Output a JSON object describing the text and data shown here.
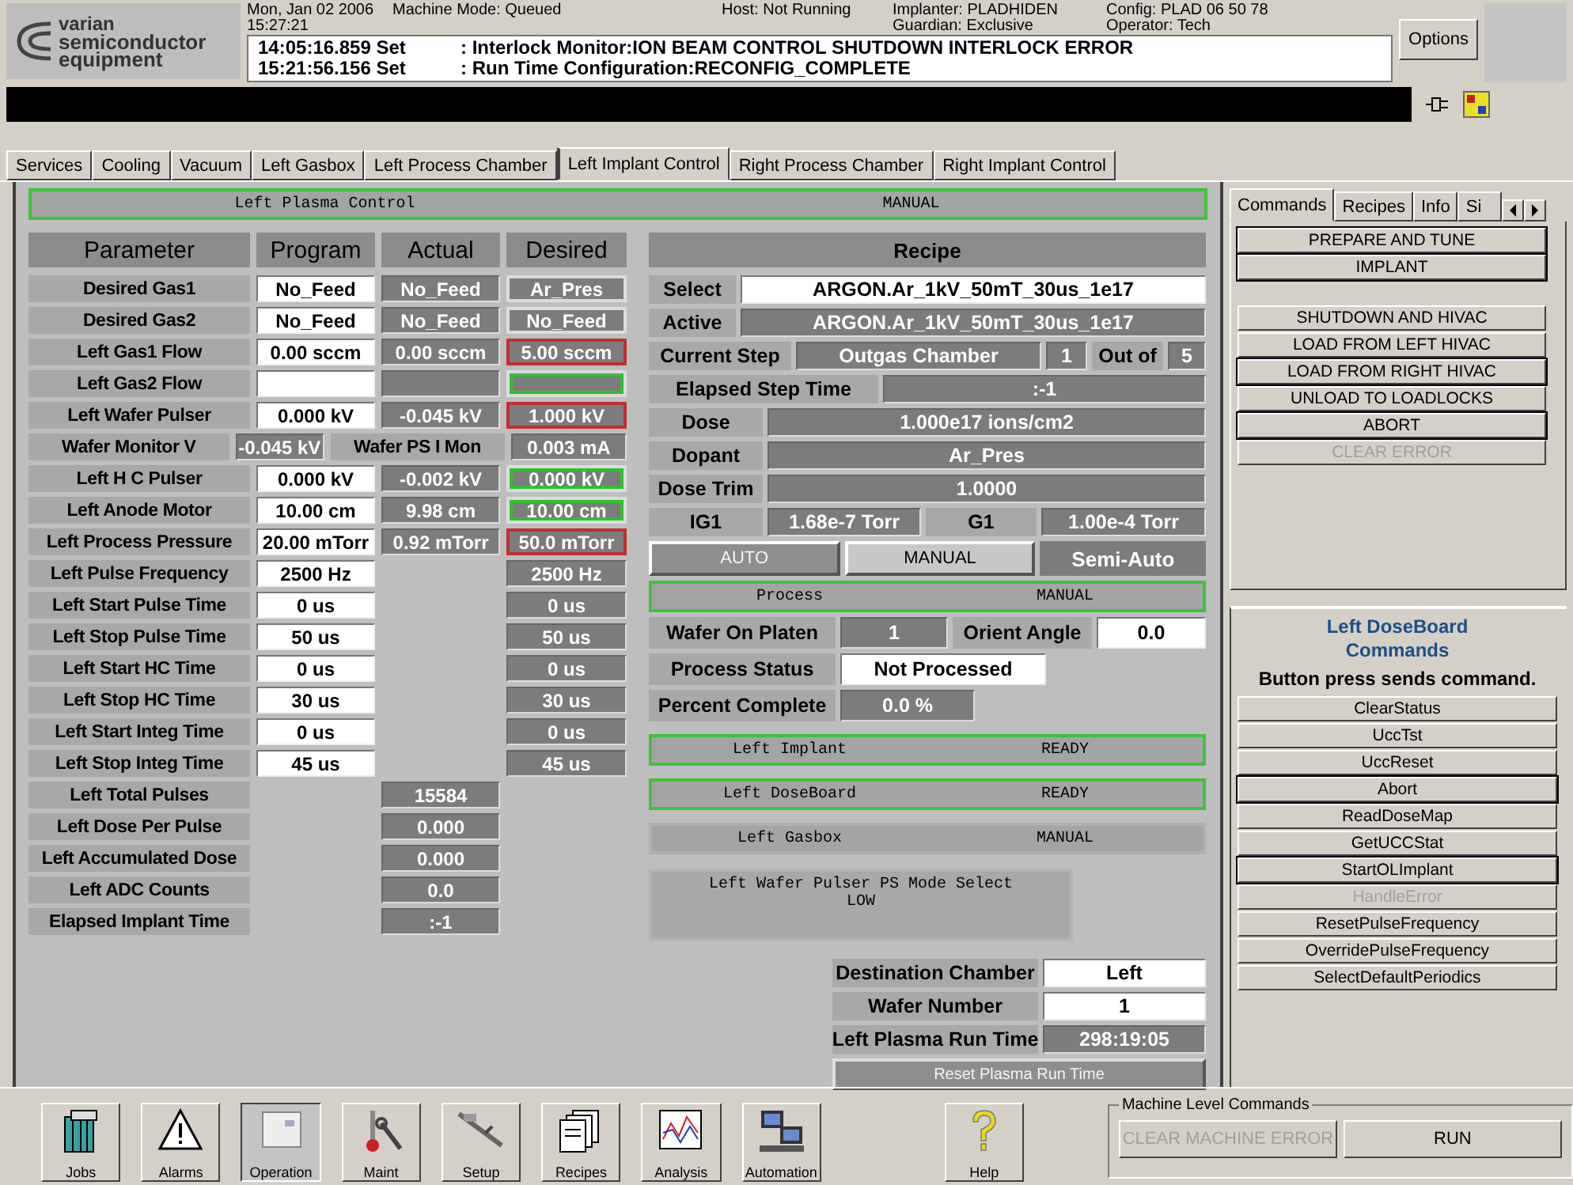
{
  "logo": {
    "lines": [
      "varian",
      "semiconductor",
      "equipment"
    ]
  },
  "header": {
    "date": "Mon, Jan 02 2006",
    "time": "15:27:21",
    "machine_mode": "Machine Mode:  Queued",
    "host": "Host:  Not Running",
    "implanter": "Implanter: PLADHIDEN",
    "guardian": "Guardian: Exclusive",
    "config": "Config: PLAD 06 50 78",
    "operator": "Operator: Tech",
    "options_button": "Options"
  },
  "messages": [
    {
      "time": "14:05:16.859 Set",
      "text": ": Interlock Monitor:ION BEAM CONTROL SHUTDOWN INTERLOCK ERROR"
    },
    {
      "time": "15:21:56.156 Set",
      "text": ": Run Time Configuration:RECONFIG_COMPLETE"
    }
  ],
  "tabs": [
    {
      "label": "Services",
      "selected": false
    },
    {
      "label": "Cooling",
      "selected": false
    },
    {
      "label": "Vacuum",
      "selected": false
    },
    {
      "label": "Left Gasbox",
      "selected": false
    },
    {
      "label": "Left Process Chamber",
      "selected": false
    },
    {
      "label": "Left Implant Control",
      "selected": true
    },
    {
      "label": "Right Process Chamber",
      "selected": false
    },
    {
      "label": "Right Implant Control",
      "selected": false
    }
  ],
  "plasma_bar": {
    "label": "Left Plasma Control",
    "status": "MANUAL",
    "outlined": true
  },
  "parameters": {
    "columns": [
      "Parameter",
      "Program",
      "Actual",
      "Desired"
    ],
    "rows": [
      {
        "kind": "setting",
        "label": "Desired Gas1",
        "program": "No_Feed",
        "actual": "No_Feed",
        "desired": "Ar_Pres",
        "alarm": false,
        "ok": false
      },
      {
        "kind": "setting",
        "label": "Desired Gas2",
        "program": "No_Feed",
        "actual": "No_Feed",
        "desired": "No_Feed",
        "alarm": false,
        "ok": false
      },
      {
        "kind": "setting",
        "label": "Left Gas1 Flow",
        "program": "0.00 sccm",
        "actual": "0.00 sccm",
        "desired": "5.00 sccm",
        "alarm": true,
        "ok": false
      },
      {
        "kind": "setting",
        "label": "Left Gas2 Flow",
        "alarm": false,
        "ok": true
      },
      {
        "kind": "setting",
        "label": "Left Wafer Pulser",
        "program": "0.000 kV",
        "actual": "-0.045 kV",
        "desired": "1.000 kV",
        "alarm": true,
        "ok": false
      },
      {
        "kind": "monitor",
        "label": "Wafer Monitor V",
        "value": "-0.045 kV",
        "label_2": "Wafer PS I Mon",
        "value_2": "0.003 mA"
      },
      {
        "kind": "setting",
        "label": "Left H C Pulser",
        "program": "0.000 kV",
        "actual": "-0.002 kV",
        "desired": "0.000 kV",
        "alarm": false,
        "ok": true
      },
      {
        "kind": "setting",
        "label": "Left Anode Motor",
        "program": "10.00 cm",
        "actual": "9.98 cm",
        "desired": "10.00 cm",
        "alarm": false,
        "ok": true
      },
      {
        "kind": "setting",
        "label": "Left Process Pressure",
        "program": "20.00 mTorr",
        "actual": "0.92 mTorr",
        "desired": "50.0 mTorr",
        "alarm": true,
        "ok": false
      },
      {
        "kind": "timing",
        "label": "Left Pulse Frequency",
        "program": "2500 Hz",
        "desired": "2500 Hz"
      },
      {
        "kind": "timing",
        "label": "Left Start Pulse Time",
        "program": "0 us",
        "desired": "0 us"
      },
      {
        "kind": "timing",
        "label": "Left Stop Pulse Time",
        "program": "50 us",
        "desired": "50 us"
      },
      {
        "kind": "timing",
        "label": "Left Start HC Time",
        "program": "0 us",
        "desired": "0 us"
      },
      {
        "kind": "timing",
        "label": "Left Stop HC Time",
        "program": "30 us",
        "desired": "30 us"
      },
      {
        "kind": "timing",
        "label": "Left Start Integ Time",
        "program": "0 us",
        "desired": "0 us"
      },
      {
        "kind": "timing",
        "label": "Left Stop Integ Time",
        "program": "45 us",
        "desired": "45 us"
      },
      {
        "kind": "readout",
        "label": "Left Total Pulses",
        "actual": "15584"
      },
      {
        "kind": "readout",
        "label": "Left Dose Per Pulse",
        "actual": "0.000"
      },
      {
        "kind": "readout",
        "label": "Left Accumulated Dose",
        "actual": "0.000"
      },
      {
        "kind": "readout",
        "label": "Left ADC Counts",
        "actual": "0.0"
      },
      {
        "kind": "readout",
        "label": "Elapsed Implant Time",
        "actual": ":-1"
      }
    ]
  },
  "recipe": {
    "title": "Recipe",
    "select": {
      "label": "Select",
      "value": "ARGON.Ar_1kV_50mT_30us_1e17"
    },
    "active": {
      "label": "Active",
      "value": "ARGON.Ar_1kV_50mT_30us_1e17"
    },
    "current_step": {
      "label": "Current Step",
      "value": "Outgas Chamber",
      "number": "1",
      "out_of_label": "Out of",
      "total": "5"
    },
    "elapsed": {
      "label": "Elapsed Step Time",
      "value": ":-1"
    },
    "readouts": [
      {
        "label": "Dose",
        "value": "1.000e17 ions/cm2"
      },
      {
        "label": "Dopant",
        "value": "Ar_Pres"
      },
      {
        "label": "Dose Trim",
        "value": "1.0000"
      }
    ],
    "gauges": [
      {
        "label": "IG1",
        "value": "1.68e-7 Torr"
      },
      {
        "label": "G1",
        "value": "1.00e-4 Torr"
      }
    ]
  },
  "mode_buttons": [
    {
      "label": "AUTO",
      "kind": "button",
      "disabled": true
    },
    {
      "label": "MANUAL",
      "kind": "button",
      "disabled": false
    },
    {
      "label": "Semi-Auto",
      "kind": "indicator",
      "disabled": false
    }
  ],
  "process_bar": {
    "label": "Process",
    "status": "MANUAL",
    "outlined": true
  },
  "process": {
    "wafer_on_platen": {
      "label": "Wafer On Platen",
      "value": "1"
    },
    "orient_angle": {
      "label": "Orient Angle",
      "value": "0.0"
    },
    "process_status": {
      "label": "Process Status",
      "value": "Not Processed"
    },
    "percent_complete": {
      "label": "Percent Complete",
      "value": "0.0 %"
    }
  },
  "subsystem_bars": [
    {
      "label": "Left Implant",
      "status": "READY",
      "outlined": true
    },
    {
      "label": "Left DoseBoard",
      "status": "READY",
      "outlined": true
    },
    {
      "label": "Left Gasbox",
      "status": "MANUAL",
      "outlined": false
    }
  ],
  "mode_select": {
    "title": "Left Wafer Pulser PS Mode Select",
    "value": "LOW"
  },
  "destination": {
    "rows": [
      {
        "kind": "field",
        "label": "Destination Chamber",
        "value": "Left"
      },
      {
        "kind": "field",
        "label": "Wafer Number",
        "value": "1"
      },
      {
        "kind": "readout",
        "label": "Left Plasma Run Time",
        "value": "298:19:05"
      }
    ],
    "reset_button": {
      "label": "Reset Plasma Run Time",
      "disabled": true
    }
  },
  "side_tabs": [
    {
      "label": "Commands",
      "selected": true
    },
    {
      "label": "Recipes",
      "selected": false
    },
    {
      "label": "Info",
      "selected": false
    },
    {
      "label": "Si",
      "selected": false
    }
  ],
  "commands": {
    "groups": [
      {
        "buttons": [
          {
            "label": "PREPARE AND TUNE",
            "disabled": false,
            "framed": true
          },
          {
            "label": "IMPLANT",
            "disabled": false,
            "framed": true
          }
        ]
      },
      {
        "buttons": [
          {
            "label": "SHUTDOWN AND HIVAC",
            "disabled": false,
            "framed": false
          },
          {
            "label": "LOAD FROM LEFT HIVAC",
            "disabled": false,
            "framed": false
          },
          {
            "label": "LOAD FROM RIGHT HIVAC",
            "disabled": false,
            "framed": true
          },
          {
            "label": "UNLOAD TO LOADLOCKS",
            "disabled": false,
            "framed": false
          },
          {
            "label": "ABORT",
            "disabled": false,
            "framed": true
          },
          {
            "label": "CLEAR ERROR",
            "disabled": true,
            "framed": false
          }
        ]
      }
    ]
  },
  "doseboard": {
    "title": "Left DoseBoard Commands",
    "subtitle": "Button press sends command.",
    "buttons": [
      {
        "label": "ClearStatus",
        "disabled": false,
        "framed": false
      },
      {
        "label": "UccTst",
        "disabled": false,
        "framed": false
      },
      {
        "label": "UccReset",
        "disabled": false,
        "framed": false
      },
      {
        "label": "Abort",
        "disabled": false,
        "framed": true
      },
      {
        "label": "ReadDoseMap",
        "disabled": false,
        "framed": false
      },
      {
        "label": "GetUCCStat",
        "disabled": false,
        "framed": false
      },
      {
        "label": "StartOLImplant",
        "disabled": false,
        "framed": true
      },
      {
        "label": "HandleError",
        "disabled": true,
        "framed": false
      },
      {
        "label": "ResetPulseFrequency",
        "disabled": false,
        "framed": false
      },
      {
        "label": "OverridePulseFrequency",
        "disabled": false,
        "framed": false
      },
      {
        "label": "SelectDefaultPeriodics",
        "disabled": false,
        "framed": false
      }
    ]
  },
  "toolbar": [
    {
      "label": "Jobs",
      "selected": false
    },
    {
      "label": "Alarms",
      "selected": false
    },
    {
      "label": "Operation",
      "selected": true
    },
    {
      "label": "Maint",
      "selected": false
    },
    {
      "label": "Setup",
      "selected": false
    },
    {
      "label": "Recipes",
      "selected": false
    },
    {
      "label": "Analysis",
      "selected": false
    },
    {
      "label": "Automation",
      "selected": false
    }
  ],
  "help_button": {
    "label": "Help"
  },
  "machine_commands": {
    "title": "Machine Level Commands",
    "buttons": [
      {
        "label": "CLEAR MACHINE ERROR",
        "disabled": true
      },
      {
        "label": "RUN",
        "disabled": false
      }
    ]
  }
}
